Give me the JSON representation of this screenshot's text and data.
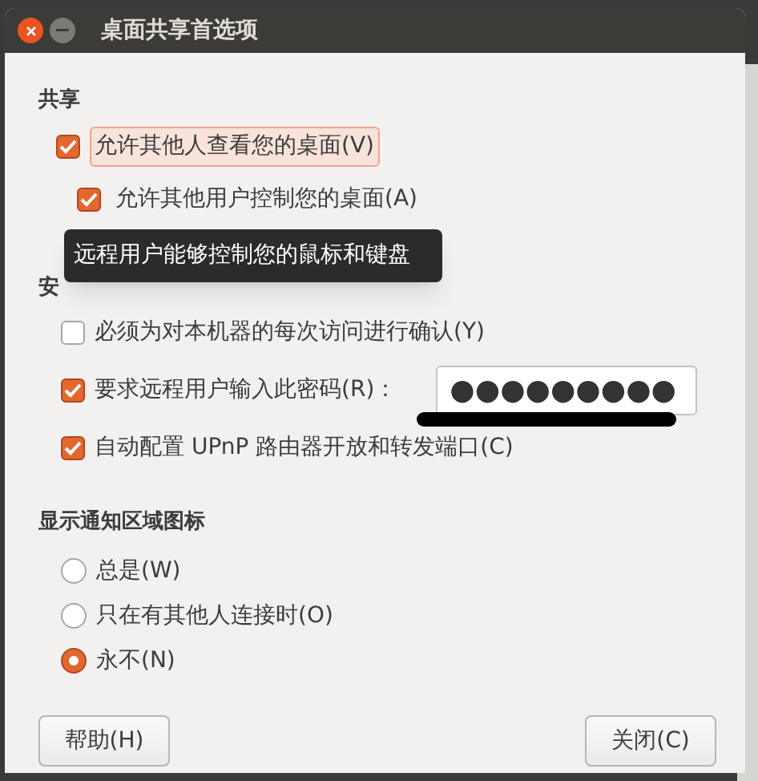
{
  "window": {
    "title": "桌面共享首选项"
  },
  "sharing": {
    "heading": "共享",
    "items": [
      {
        "label": "允许其他人查看您的桌面(V)",
        "checked": true,
        "focused": true,
        "children": [
          {
            "label": "允许其他用户控制您的桌面(A)",
            "checked": true,
            "focused": false
          }
        ]
      }
    ]
  },
  "tooltip": {
    "text": "远程用户能够控制您的鼠标和键盘"
  },
  "security": {
    "heading": "安",
    "items": [
      {
        "kind": "checkbox",
        "label": "必须为对本机器的每次访问进行确认(Y)",
        "checked": false
      },
      {
        "kind": "password",
        "label": "要求远程用户输入此密码(R)：",
        "checked": true,
        "value": "●●●●●●●●●"
      },
      {
        "kind": "checkbox",
        "label": "自动配置 UPnP 路由器开放和转发端口(C)",
        "checked": true
      }
    ]
  },
  "notification_icon": {
    "heading": "显示通知区域图标",
    "options": [
      {
        "label": "总是(W)",
        "selected": false
      },
      {
        "label": "只在有其他人连接时(O)",
        "selected": false
      },
      {
        "label": "永不(N)",
        "selected": true
      }
    ]
  },
  "buttons": [
    "帮助(H)",
    "关闭(C)"
  ]
}
